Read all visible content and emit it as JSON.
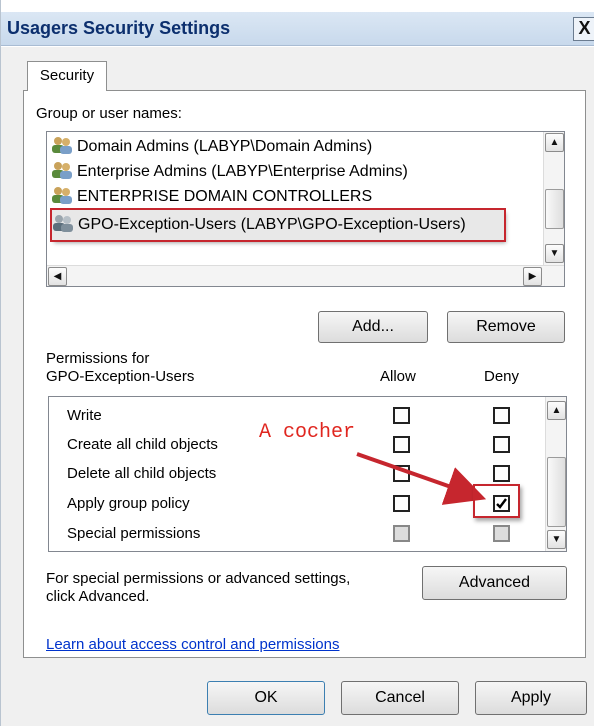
{
  "window": {
    "title": "Usagers Security Settings",
    "close_glyph": "X"
  },
  "tabs": [
    {
      "label": "Security"
    }
  ],
  "group_section": {
    "label": "Group or user names:",
    "items": [
      {
        "label": "Domain Admins (LABYP\\Domain Admins)",
        "icon": "users-icon"
      },
      {
        "label": "Enterprise Admins (LABYP\\Enterprise Admins)",
        "icon": "users-icon"
      },
      {
        "label": "ENTERPRISE DOMAIN CONTROLLERS",
        "icon": "users-icon"
      },
      {
        "label": "GPO-Exception-Users (LABYP\\GPO-Exception-Users)",
        "icon": "users-icon"
      }
    ],
    "selected_index": 3
  },
  "buttons": {
    "add": "Add...",
    "remove": "Remove",
    "advanced": "Advanced",
    "ok": "OK",
    "cancel": "Cancel",
    "apply": "Apply"
  },
  "permissions": {
    "header_line1": "Permissions for",
    "header_line2": "GPO-Exception-Users",
    "allow_label": "Allow",
    "deny_label": "Deny",
    "rows": [
      {
        "name": "Write",
        "allow": false,
        "deny": false,
        "disabled": false
      },
      {
        "name": "Create all child objects",
        "allow": false,
        "deny": false,
        "disabled": false
      },
      {
        "name": "Delete all child objects",
        "allow": false,
        "deny": false,
        "disabled": false
      },
      {
        "name": "Apply group policy",
        "allow": false,
        "deny": true,
        "disabled": false
      },
      {
        "name": "Special permissions",
        "allow": false,
        "deny": false,
        "disabled": true
      }
    ]
  },
  "advanced_note": {
    "line1": "For special permissions or advanced settings,",
    "line2": "click Advanced."
  },
  "link": "Learn about access control and permissions",
  "annotation": {
    "text": "A cocher",
    "color": "#e0261f"
  },
  "colors": {
    "title_bar": "#c8d9ec",
    "title_text": "#0c2f6e",
    "highlight": "#c6262e",
    "link": "#0033cc"
  }
}
